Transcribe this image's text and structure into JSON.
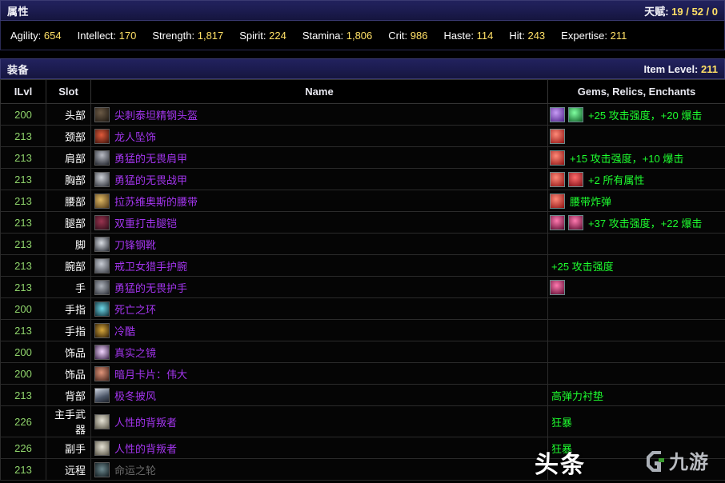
{
  "attributes_panel": {
    "title": "属性",
    "talents_label": "天赋:",
    "talents_value": "19 / 52 / 0",
    "stats": [
      {
        "name": "Agility:",
        "value": "654"
      },
      {
        "name": "Intellect:",
        "value": "170"
      },
      {
        "name": "Strength:",
        "value": "1,817"
      },
      {
        "name": "Spirit:",
        "value": "224"
      },
      {
        "name": "Stamina:",
        "value": "1,806"
      },
      {
        "name": "Crit:",
        "value": "986"
      },
      {
        "name": "Haste:",
        "value": "114"
      },
      {
        "name": "Hit:",
        "value": "243"
      },
      {
        "name": "Expertise:",
        "value": "211"
      }
    ]
  },
  "gear_panel": {
    "title": "装备",
    "item_level_label": "Item Level:",
    "item_level_value": "211",
    "columns": [
      "ILvl",
      "Slot",
      "Name",
      "Gems, Relics, Enchants"
    ],
    "rows": [
      {
        "ilvl": "200",
        "slot": "头部",
        "name": "尖刺泰坦精钢头盔",
        "quality": "epic",
        "icon": "helm-icon",
        "gems": [
          "gem-purple",
          "gem-green"
        ],
        "enchant": "+25 攻击强度，+20 爆击"
      },
      {
        "ilvl": "213",
        "slot": "颈部",
        "name": "龙人坠饰",
        "quality": "epic",
        "icon": "neck-icon",
        "gems": [
          "gem-red"
        ],
        "enchant": ""
      },
      {
        "ilvl": "213",
        "slot": "肩部",
        "name": "勇猛的无畏肩甲",
        "quality": "epic",
        "icon": "shoulder-icon",
        "gems": [
          "gem-red"
        ],
        "enchant": "+15 攻击强度，+10 爆击"
      },
      {
        "ilvl": "213",
        "slot": "胸部",
        "name": "勇猛的无畏战甲",
        "quality": "epic",
        "icon": "chest-icon",
        "gems": [
          "gem-red",
          "gem-red2"
        ],
        "enchant": "+2 所有属性"
      },
      {
        "ilvl": "213",
        "slot": "腰部",
        "name": "拉苏维奥斯的腰带",
        "quality": "epic",
        "icon": "belt-icon",
        "gems": [
          "gem-red"
        ],
        "enchant": "腰带炸弹"
      },
      {
        "ilvl": "213",
        "slot": "腿部",
        "name": "双重打击腿铠",
        "quality": "epic",
        "icon": "legs-icon",
        "gems": [
          "gem-pink",
          "gem-pink"
        ],
        "enchant": "+37 攻击强度，+22 爆击"
      },
      {
        "ilvl": "213",
        "slot": "脚",
        "name": "刀锋钢靴",
        "quality": "epic",
        "icon": "feet-icon",
        "gems": [],
        "enchant": ""
      },
      {
        "ilvl": "213",
        "slot": "腕部",
        "name": "戒卫女猎手护腕",
        "quality": "epic",
        "icon": "wrist-icon",
        "gems": [],
        "enchant": "+25 攻击强度"
      },
      {
        "ilvl": "213",
        "slot": "手",
        "name": "勇猛的无畏护手",
        "quality": "epic",
        "icon": "hands-icon",
        "gems": [
          "gem-pink"
        ],
        "enchant": ""
      },
      {
        "ilvl": "200",
        "slot": "手指",
        "name": "死亡之环",
        "quality": "epic",
        "icon": "ring-icon",
        "gems": [],
        "enchant": ""
      },
      {
        "ilvl": "213",
        "slot": "手指",
        "name": "冷酷",
        "quality": "epic",
        "icon": "ring2-icon",
        "gems": [],
        "enchant": ""
      },
      {
        "ilvl": "200",
        "slot": "饰品",
        "name": "真实之镜",
        "quality": "epic",
        "icon": "trinket-icon",
        "gems": [],
        "enchant": ""
      },
      {
        "ilvl": "200",
        "slot": "饰品",
        "name": "暗月卡片：伟大",
        "quality": "epic",
        "icon": "trinket2-icon",
        "gems": [],
        "enchant": ""
      },
      {
        "ilvl": "213",
        "slot": "背部",
        "name": "极冬披风",
        "quality": "epic",
        "icon": "cloak-icon",
        "gems": [],
        "enchant": "高弹力衬垫"
      },
      {
        "ilvl": "226",
        "slot": "主手武器",
        "name": "人性的背叛者",
        "quality": "epic",
        "icon": "weapon-icon",
        "gems": [],
        "enchant": "狂暴"
      },
      {
        "ilvl": "226",
        "slot": "副手",
        "name": "人性的背叛者",
        "quality": "epic",
        "icon": "weapon-icon",
        "gems": [],
        "enchant": "狂暴"
      },
      {
        "ilvl": "213",
        "slot": "远程",
        "name": "命运之轮",
        "quality": "poor",
        "icon": "ranged-icon",
        "gems": [],
        "enchant": ""
      }
    ]
  },
  "watermark": {
    "toutiao": "头条",
    "jiuyou": "九游"
  },
  "colors": {
    "header_bg": "#1c1c50",
    "stat_value": "#ffe066",
    "ilvl": "#8fd36b",
    "epic": "#a335ee",
    "poor": "#6b6b6b",
    "enchant": "#1eff2f"
  }
}
